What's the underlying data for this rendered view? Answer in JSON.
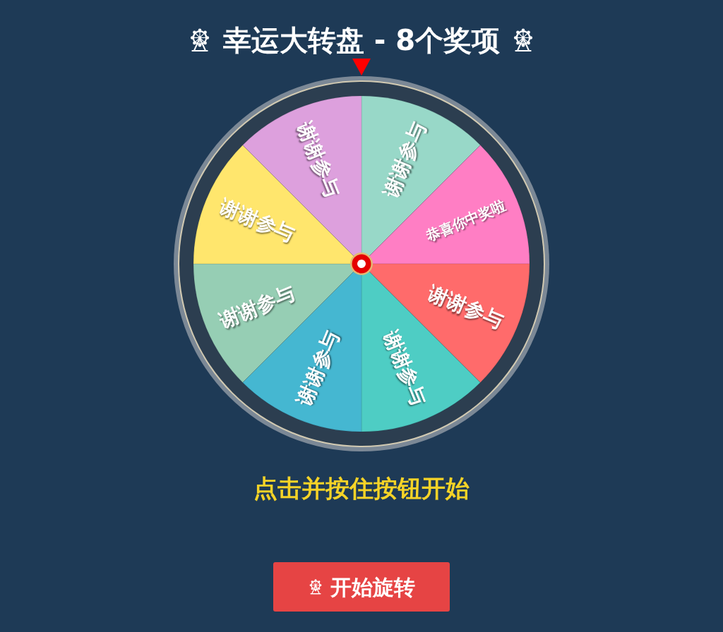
{
  "title": {
    "text": "幸运大转盘 - 8个奖项"
  },
  "wheel": {
    "segments": [
      {
        "label": "谢谢参与",
        "color": "#98d8c8"
      },
      {
        "label": "恭喜你中奖啦",
        "color": "#ff7ec4"
      },
      {
        "label": "谢谢参与",
        "color": "#ff6b6b"
      },
      {
        "label": "谢谢参与",
        "color": "#4ecdc4"
      },
      {
        "label": "谢谢参与",
        "color": "#45b7d1"
      },
      {
        "label": "谢谢参与",
        "color": "#96ceb4"
      },
      {
        "label": "谢谢参与",
        "color": "#ffe66d"
      },
      {
        "label": "谢谢参与",
        "color": "#dda0dd"
      }
    ]
  },
  "hint": "点击并按住按钮开始",
  "button": {
    "label": "开始旋转"
  }
}
